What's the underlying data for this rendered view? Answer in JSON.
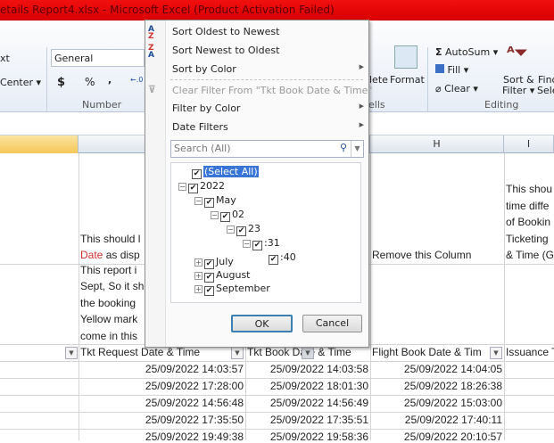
{
  "window": {
    "title": "etails Report4.xlsx  -  Microsoft Excel (Product Activation Failed)"
  },
  "ribbon": {
    "wrap_text": "xt",
    "merge_center": "Center ▾",
    "number_format": "General",
    "currency": "$",
    "percent": "%",
    "comma": ",",
    "increase_decimal": "←.0 .00",
    "number_group": "Number",
    "delete_label": "lete",
    "format_label": "Format",
    "cells_group": "ells",
    "autosum": "AutoSum ▾",
    "fill": "Fill ▾",
    "clear": "Clear ▾",
    "sort_filter": "Sort &",
    "sort_filter2": "Filter ▾",
    "find": "Find",
    "find2": "Sele",
    "editing_group": "Editing"
  },
  "columns": {
    "H": "H",
    "I": "I"
  },
  "cells": {
    "g1a": "This should l",
    "g1b_red": "Date",
    "g1b": " as disp",
    "h1": "Remove this Column",
    "i1": [
      "This shou",
      "time diffe",
      "of Bookin",
      "Ticketing",
      "& Time (G"
    ],
    "g2": [
      "This report i",
      "Sept, So it sh",
      "the booking",
      "Yellow mark",
      "come in this"
    ]
  },
  "table": {
    "headers": [
      "Tkt Request Date & Time",
      "Tkt Book Date & Time",
      "Flight Book Date & Tim",
      "Issuance T"
    ],
    "rows": [
      [
        "25/09/2022 14:03:57",
        "25/09/2022 14:03:58",
        "25/09/2022 14:04:05"
      ],
      [
        "25/09/2022 17:28:00",
        "25/09/2022 18:01:30",
        "25/09/2022 18:26:38"
      ],
      [
        "25/09/2022 14:56:48",
        "25/09/2022 14:56:49",
        "25/09/2022 15:03:00"
      ],
      [
        "25/09/2022 17:35:50",
        "25/09/2022 17:35:51",
        "25/09/2022 17:40:11"
      ],
      [
        "25/09/2022 19:49:38",
        "25/09/2022 19:58:36",
        "25/09/2022 20:10:57"
      ]
    ]
  },
  "filter_menu": {
    "sort_asc": "Sort Oldest to Newest",
    "sort_desc": "Sort Newest to Oldest",
    "sort_color": "Sort by Color",
    "clear_filter": "Clear Filter From \"Tkt Book Date & Time\"",
    "filter_color": "Filter by Color",
    "date_filters": "Date Filters",
    "search_placeholder": "Search (All)",
    "tree": [
      {
        "label": "(Select All)",
        "checked": true
      },
      {
        "label": "2022",
        "checked": true
      },
      {
        "label": "May",
        "checked": true
      },
      {
        "label": "02",
        "checked": true
      },
      {
        "label": "23",
        "checked": true
      },
      {
        "label": ":31",
        "checked": true
      },
      {
        "label": ":40",
        "checked": true
      },
      {
        "label": "July",
        "checked": true
      },
      {
        "label": "August",
        "checked": true
      },
      {
        "label": "September",
        "checked": true
      }
    ],
    "ok": "OK",
    "cancel": "Cancel"
  },
  "colors": {
    "title_bar": "#e00000",
    "selection": "#3875d7",
    "red_text": "#d03030",
    "col_a_header": "#f9d67a"
  }
}
